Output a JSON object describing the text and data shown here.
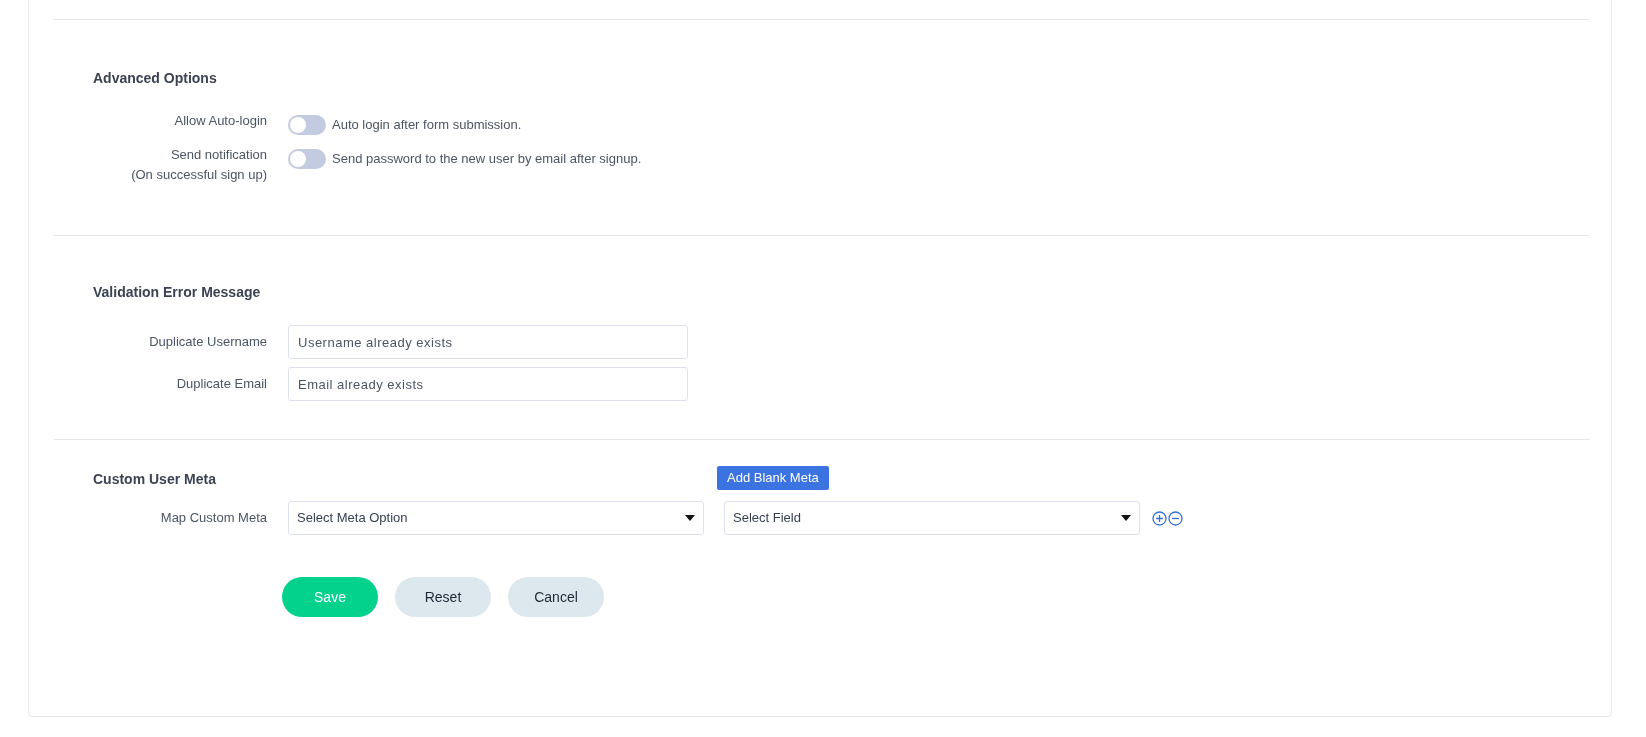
{
  "advanced_options": {
    "title": "Advanced Options",
    "toggles": [
      {
        "label": [
          "Allow Auto-login"
        ],
        "on": false,
        "description": "Auto login after form submission."
      },
      {
        "label": [
          "Send notification",
          "(On successful sign up)"
        ],
        "on": false,
        "description": "Send password to the new user by email after signup."
      }
    ]
  },
  "validation_error_message": {
    "title": "Validation Error Message",
    "fields": [
      {
        "label": "Duplicate Username",
        "value": "Username already exists"
      },
      {
        "label": "Duplicate Email",
        "value": "Email already exists"
      }
    ]
  },
  "custom_user_meta": {
    "title": "Custom User Meta",
    "add_button": "Add Blank Meta",
    "label": "Map Custom Meta",
    "selects": [
      {
        "value": "Select Meta Option"
      },
      {
        "value": "Select Field"
      }
    ]
  },
  "buttons": [
    {
      "label": "Save",
      "kind": "primary"
    },
    {
      "label": "Reset",
      "kind": "secondary"
    },
    {
      "label": "Cancel",
      "kind": "secondary"
    }
  ]
}
